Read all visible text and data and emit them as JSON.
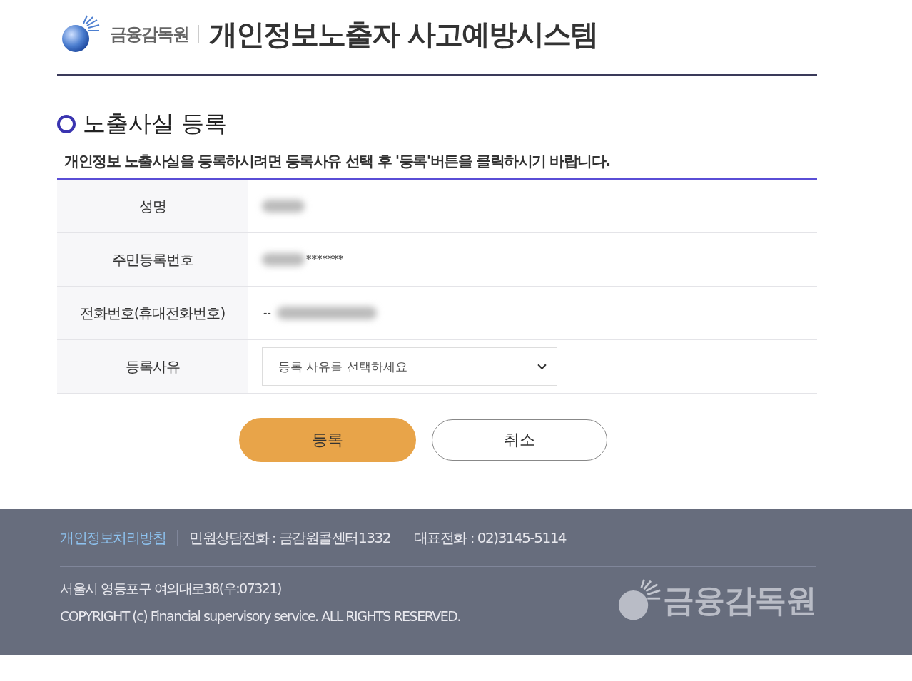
{
  "header": {
    "org_name": "금융감독원",
    "title": "개인정보노출자 사고예방시스템"
  },
  "section": {
    "title": "노출사실 등록",
    "instruction": "개인정보 노출사실을 등록하시려면 등록사유 선택 후 '등록'버튼을 클릭하시기 바랍니다."
  },
  "form_rows": [
    {
      "label": "성명",
      "kind": "hidden"
    },
    {
      "label": "주민등록번호",
      "kind": "masked",
      "visible_text": "*******"
    },
    {
      "label": "전화번호(휴대전화번호)",
      "kind": "phone",
      "visible_text": "--"
    },
    {
      "label": "등록사유",
      "kind": "select",
      "placeholder": "등록 사유를 선택하세요"
    }
  ],
  "buttons": [
    {
      "label": "등록",
      "kind": "primary"
    },
    {
      "label": "취소",
      "kind": "secondary"
    }
  ],
  "footer": {
    "links": [
      {
        "text": "개인정보처리방침",
        "kind": "link"
      },
      {
        "text": "민원상담전화 : 금감원콜센터1332",
        "kind": "text"
      },
      {
        "text": "대표전화 : 02)3145-5114",
        "kind": "text"
      }
    ],
    "address": "서울시 영등포구 여의대로38(우:07321)",
    "copyright": "COPYRIGHT (c) Financial supervisory service. ALL RIGHTS RESERVED.",
    "logo_text": "금융감독원"
  }
}
